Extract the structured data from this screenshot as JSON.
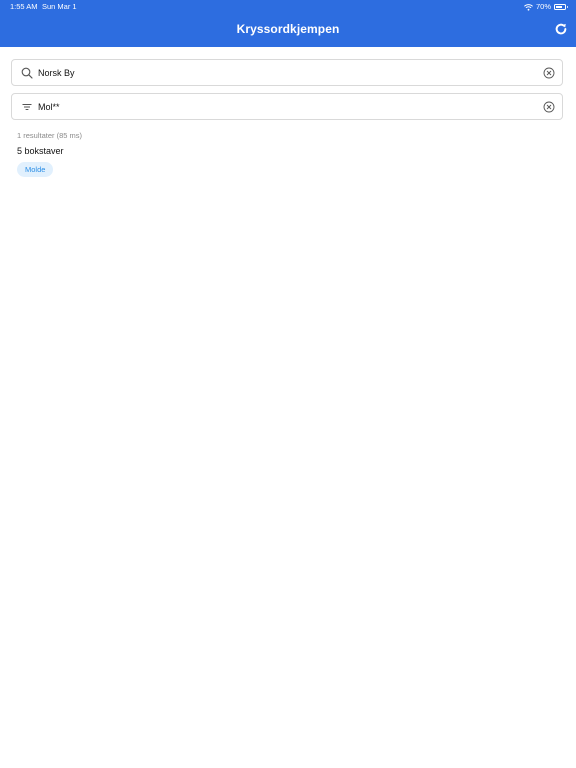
{
  "status_bar": {
    "time": "1:55 AM",
    "date": "Sun Mar 1",
    "battery": "70%",
    "battery_level": 0.7
  },
  "header": {
    "title": "Kryssordkjempen",
    "refresh_icon": "refresh-icon"
  },
  "search": {
    "value": "Norsk By",
    "icon": "search-icon",
    "clear_icon": "clear-icon"
  },
  "filter": {
    "value": "Mol**",
    "icon": "filter-icon",
    "clear_icon": "clear-icon"
  },
  "results": {
    "count_text": "1 resultater (85 ms)",
    "groups": [
      {
        "heading": "5 bokstaver",
        "words": [
          "Molde"
        ]
      }
    ]
  },
  "colors": {
    "header_bg": "#2d6de0",
    "chip_bg": "#e1f0fd",
    "chip_text": "#2b8ee6"
  }
}
